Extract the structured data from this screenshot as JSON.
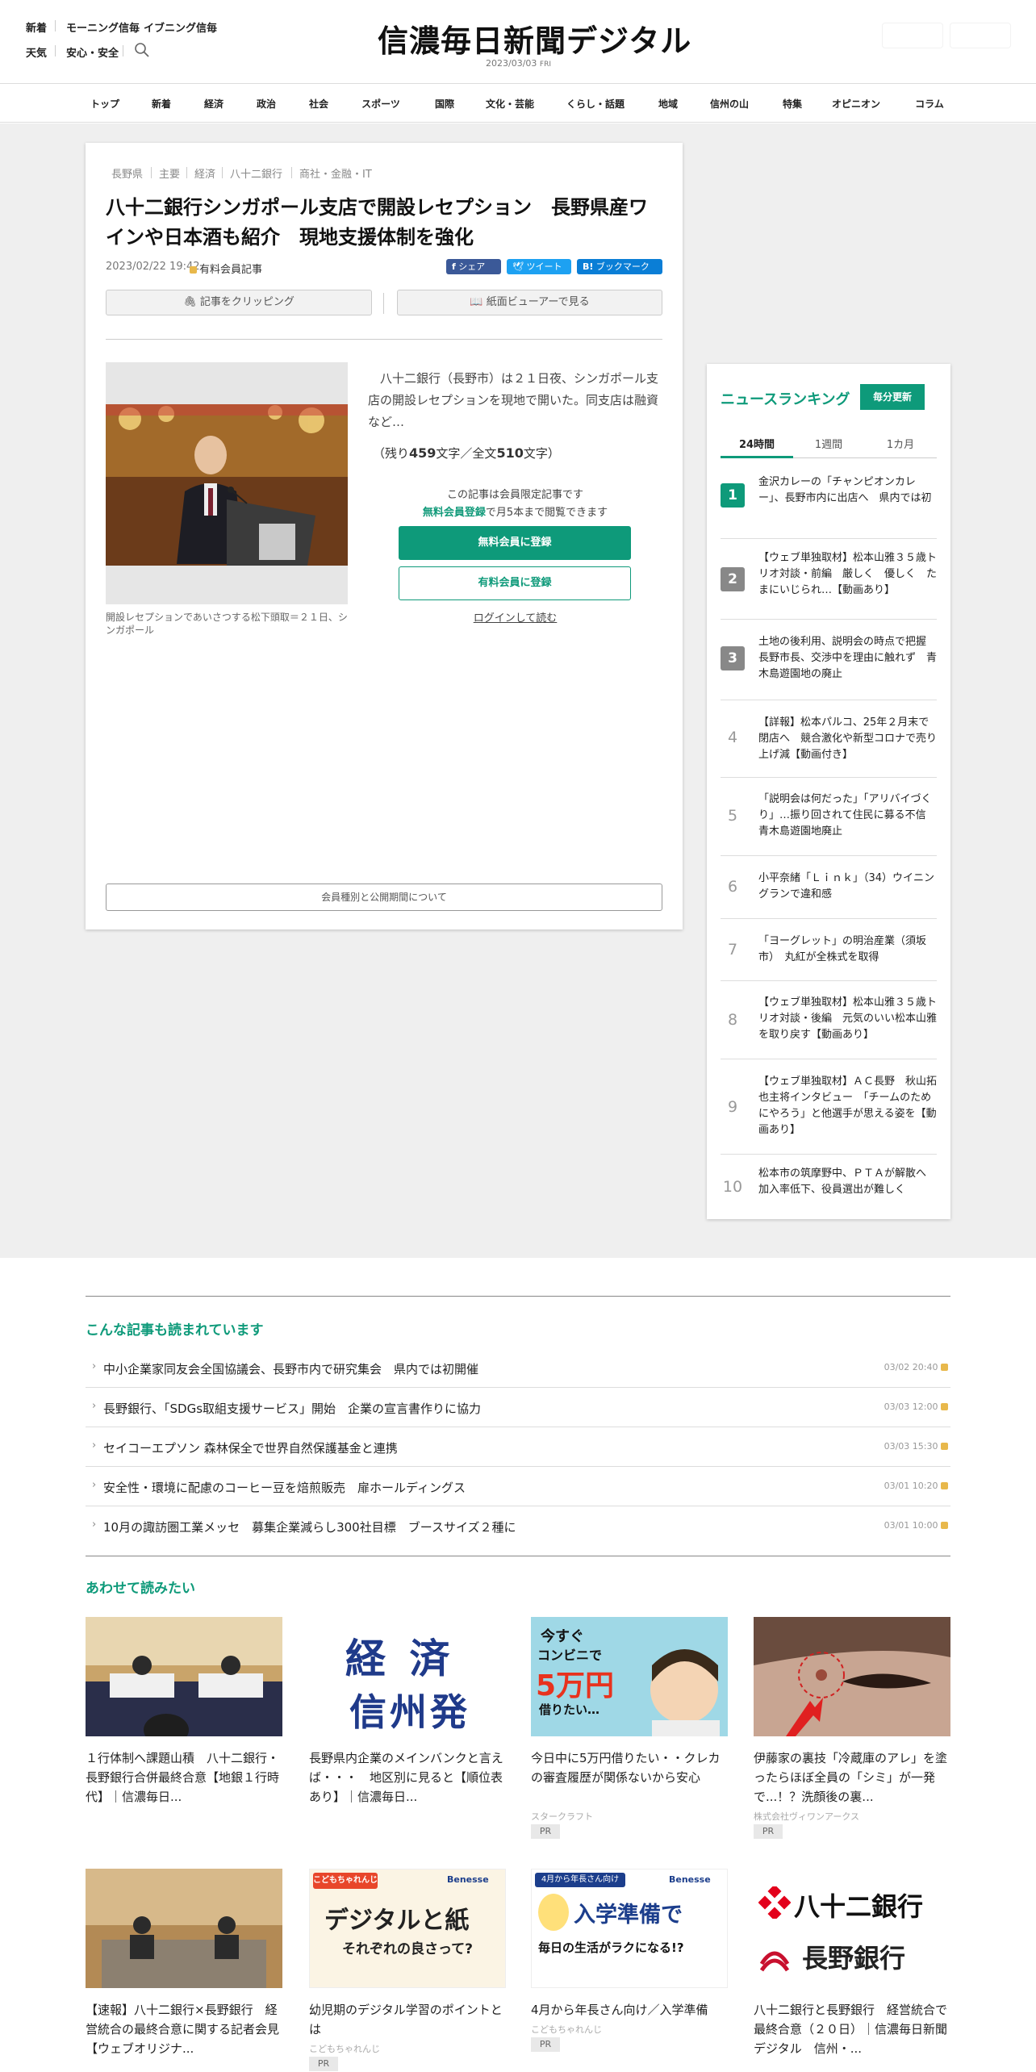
{
  "header": {
    "links_row1": [
      "新着",
      "モーニング信毎",
      "イブニング信毎"
    ],
    "links_row2": [
      "天気",
      "安心・安全"
    ],
    "logo": "信濃毎日新聞デジタル",
    "date": "2023/03/03",
    "weekday": "FRI"
  },
  "nav": [
    "トップ",
    "新着",
    "経済",
    "政治",
    "社会",
    "スポーツ",
    "国際",
    "文化・芸能",
    "くらし・話題",
    "地域",
    "信州の山",
    "特集",
    "オピニオン",
    "コラム"
  ],
  "article": {
    "tags": [
      "長野県",
      "主要",
      "経済",
      "八十二銀行",
      "商社・金融・IT"
    ],
    "title": "八十二銀行シンガポール支店で開設レセプション　長野県産ワインや日本酒も紹介　現地支援体制を強化",
    "date": "2023/02/22 19:42",
    "paid_label": "有料会員記事",
    "share": {
      "fb": "シェア",
      "tw": "ツイート",
      "hb": "ブックマーク"
    },
    "clip": "記事をクリッピング",
    "viewer": "紙面ビューアーで見る",
    "caption": "開設レセプションであいさつする松下頭取＝２１日、シンガポール",
    "lead": "八十二銀行（長野市）は２１日夜、シンガポール支店の開設レセプションを現地で開いた。同支店は融資など…",
    "remain_prefix": "（残り",
    "remain_count": "459",
    "remain_mid": "文字／全文",
    "total_count": "510",
    "remain_suffix": "文字）",
    "member_note": "この記事は会員限定記事です",
    "free_reg_link": "無料会員登録",
    "free_reg_rest": "で月5本まで閲覧できます",
    "btn_free": "無料会員に登録",
    "btn_paid": "有料会員に登録",
    "login": "ログインして読む",
    "membership_info": "会員種別と公開期間について"
  },
  "ranking": {
    "title": "ニュースランキング",
    "badge": "毎分更新",
    "tabs": [
      "24時間",
      "1週間",
      "1カ月"
    ],
    "items": [
      {
        "n": "1",
        "text": "金沢カレーの「チャンピオンカレー」、長野市内に出店へ　県内では初"
      },
      {
        "n": "2",
        "text": "【ウェブ単独取材】松本山雅３５歳トリオ対談・前編　厳しく　優しく　たまにいじられ…【動画あり】"
      },
      {
        "n": "3",
        "text": "土地の後利用、説明会の時点で把握　長野市長、交渉中を理由に触れず　青木島遊園地の廃止"
      },
      {
        "n": "4",
        "text": "【詳報】松本パルコ、25年２月末で閉店へ　競合激化や新型コロナで売り上げ減【動画付き】"
      },
      {
        "n": "5",
        "text": "「説明会は何だった」「アリバイづくり」…振り回されて住民に募る不信　青木島遊園地廃止"
      },
      {
        "n": "6",
        "text": "小平奈緒「Ｌｉｎｋ」（34）ウイニングランで違和感"
      },
      {
        "n": "7",
        "text": "「ヨーグレット」の明治産業（須坂市）　丸紅が全株式を取得"
      },
      {
        "n": "8",
        "text": "【ウェブ単独取材】松本山雅３５歳トリオ対談・後編　元気のいい松本山雅を取り戻す【動画あり】"
      },
      {
        "n": "9",
        "text": "【ウェブ単独取材】ＡＣ長野　秋山拓也主将インタビュー　「チームのためにやろう」と他選手が思える姿を【動画あり】"
      },
      {
        "n": "10",
        "text": "松本市の筑摩野中、ＰＴＡが解散へ　加入率低下、役員選出が難しく"
      }
    ]
  },
  "related": {
    "title": "こんな記事も読まれています",
    "items": [
      {
        "text": "中小企業家同友会全国協議会、長野市内で研究集会　県内では初開催",
        "date": "03/02 20:40"
      },
      {
        "text": "長野銀行、「SDGs取組支援サービス」開始　企業の宣言書作りに協力",
        "date": "03/03 12:00"
      },
      {
        "text": "セイコーエプソン 森林保全で世界自然保護基金と連携",
        "date": "03/03 15:30"
      },
      {
        "text": "安全性・環境に配慮のコーヒー豆を焙煎販売　扉ホールディングス",
        "date": "03/01 10:20"
      },
      {
        "text": "10月の諏訪圏工業メッセ　募集企業減らし300社目標　ブースサイズ２種に",
        "date": "03/01 10:00"
      }
    ]
  },
  "also": {
    "title": "あわせて読みたい",
    "cards": [
      {
        "title": "１行体制へ課題山積　八十二銀行・長野銀行合併最終合意【地銀１行時代】｜信濃毎日...",
        "sponsor": "",
        "pr": ""
      },
      {
        "title": "長野県内企業のメインバンクと言えば・・・　地区別に見ると【順位表あり】｜信濃毎日...",
        "sponsor": "",
        "pr": ""
      },
      {
        "title": "今日中に5万円借りたい・・クレカの審査履歴が関係ないから安心",
        "sponsor": "スタークラフト",
        "pr": "PR"
      },
      {
        "title": "伊藤家の裏技「冷蔵庫のアレ」を塗ったらほぼ全員の「シミ」が一発で...！？洗顔後の裏...",
        "sponsor": "株式会社ヴィワンアークス",
        "pr": "PR"
      },
      {
        "title": "【速報】八十二銀行×長野銀行　経営統合の最終合意に関する記者会見【ウェブオリジナ...",
        "sponsor": "",
        "pr": ""
      },
      {
        "title": "幼児期のデジタル学習のポイントとは",
        "sponsor": "こどもちゃれんじ",
        "pr": "PR"
      },
      {
        "title": "4月から年長さん向け／入学準備",
        "sponsor": "こどもちゃれんじ",
        "pr": "PR"
      },
      {
        "title": "八十二銀行と長野銀行　経営統合で最終合意（２０日）｜信濃毎日新聞デジタル　信州・...",
        "sponsor": "",
        "pr": ""
      }
    ],
    "img_text": {
      "econ_1": "経 済",
      "econ_2": "信州発",
      "loan_1": "今すぐ",
      "loan_2": "コンビニで",
      "loan_3": "5万円",
      "loan_4": "借りたい…",
      "benesse_brand": "こどもちゃれんじ",
      "benesse_logo": "Benesse",
      "digi_1": "デジタルと紙",
      "digi_2": "それぞれの良さって?",
      "prep_top": "4月から年長さん向け",
      "prep_1": "入学準備で",
      "prep_2": "毎日の生活がラクになる!?",
      "bank_1": "八十二銀行",
      "bank_2": "長野銀行"
    }
  },
  "colors": {
    "accent": "#0e9a7a",
    "fb": "#3b5998",
    "tw": "#1da1f2",
    "hb": "#0a7ed6",
    "rank1": "#0e9a7a",
    "rank23": "#888888"
  }
}
